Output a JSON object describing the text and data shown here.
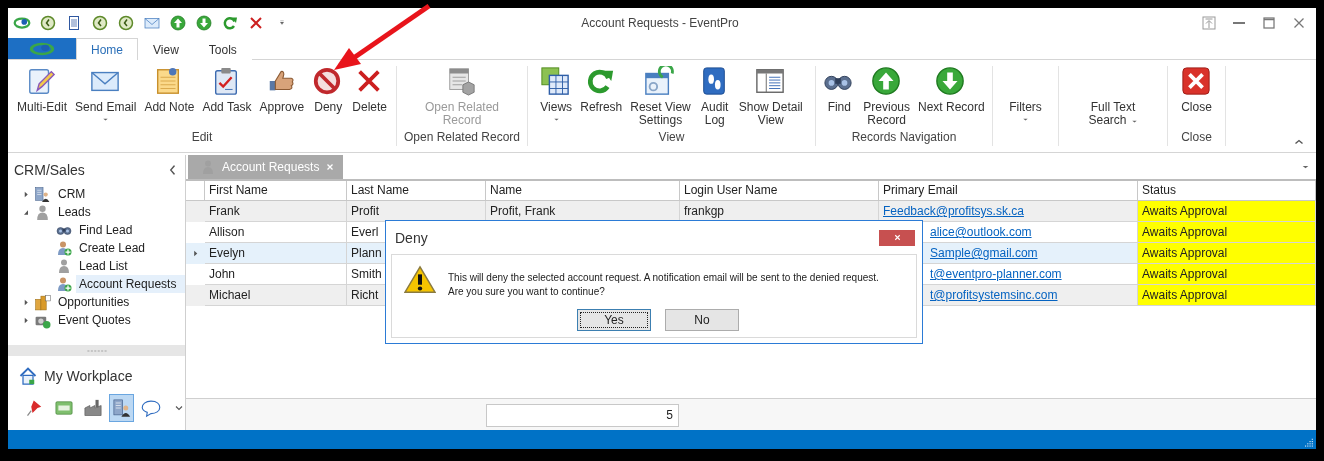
{
  "window": {
    "title": "Account Requests - EventPro"
  },
  "ribbon": {
    "tabs": [
      {
        "label": "Home",
        "selected": true
      },
      {
        "label": "View",
        "selected": false
      },
      {
        "label": "Tools",
        "selected": false
      }
    ],
    "groups": [
      {
        "label": "Edit",
        "buttons": [
          {
            "label": "Multi-Edit",
            "dropdown": false,
            "disabled": false
          },
          {
            "label": "Send Email",
            "dropdown": true,
            "disabled": false
          },
          {
            "label": "Add Note",
            "dropdown": false,
            "disabled": false
          },
          {
            "label": "Add Task",
            "dropdown": false,
            "disabled": false
          },
          {
            "label": "Approve",
            "dropdown": false,
            "disabled": false
          },
          {
            "label": "Deny",
            "dropdown": false,
            "disabled": false
          },
          {
            "label": "Delete",
            "dropdown": false,
            "disabled": false
          }
        ]
      },
      {
        "label": "Open Related Record",
        "buttons": [
          {
            "label": "Open Related\nRecord",
            "dropdown": false,
            "disabled": true
          }
        ]
      },
      {
        "label": "View",
        "buttons": [
          {
            "label": "Views",
            "dropdown": true,
            "disabled": false
          },
          {
            "label": "Refresh",
            "dropdown": false,
            "disabled": false
          },
          {
            "label": "Reset View\nSettings",
            "dropdown": false,
            "disabled": false
          },
          {
            "label": "Audit\nLog",
            "dropdown": false,
            "disabled": false
          },
          {
            "label": "Show Detail\nView",
            "dropdown": false,
            "disabled": false
          }
        ]
      },
      {
        "label": "Records Navigation",
        "buttons": [
          {
            "label": "Find",
            "dropdown": false,
            "disabled": false
          },
          {
            "label": "Previous\nRecord",
            "dropdown": false,
            "disabled": false
          },
          {
            "label": "Next Record",
            "dropdown": false,
            "disabled": false
          }
        ]
      },
      {
        "buttons": [
          {
            "label": "Filters",
            "dropdown": true,
            "disabled": false
          }
        ]
      },
      {
        "buttons": [
          {
            "label": "Full Text\nSearch",
            "dropdown": true,
            "disabled": false
          }
        ]
      },
      {
        "label": "Close",
        "buttons": [
          {
            "label": "Close",
            "dropdown": false,
            "disabled": false
          }
        ]
      }
    ]
  },
  "sidebar": {
    "title": "CRM/Sales",
    "tree": [
      {
        "label": "CRM",
        "expanded": false,
        "selected": false
      },
      {
        "label": "Leads",
        "expanded": true,
        "selected": false,
        "children": [
          {
            "label": "Find Lead",
            "selected": false
          },
          {
            "label": "Create Lead",
            "selected": false
          },
          {
            "label": "Lead List",
            "selected": false
          },
          {
            "label": "Account Requests",
            "selected": true
          }
        ]
      },
      {
        "label": "Opportunities",
        "expanded": false,
        "selected": false
      },
      {
        "label": "Event Quotes",
        "expanded": false,
        "selected": false
      }
    ],
    "workplace": "My Workplace",
    "nav_buttons": [
      {
        "selected": false
      },
      {
        "selected": false
      },
      {
        "selected": false
      },
      {
        "selected": true
      },
      {
        "selected": false
      }
    ]
  },
  "document_tab": {
    "label": "Account Requests"
  },
  "grid": {
    "columns": [
      {
        "label": "First Name",
        "kind": "text"
      },
      {
        "label": "Last Name",
        "kind": "text"
      },
      {
        "label": "Name",
        "kind": "text"
      },
      {
        "label": "Login User Name",
        "kind": "text"
      },
      {
        "label": "Primary Email",
        "kind": "link"
      },
      {
        "label": "Status",
        "kind": "text"
      }
    ],
    "rows": [
      {
        "selected": false,
        "highlighted": true,
        "cells": [
          "Frank",
          "Profit",
          "Profit, Frank",
          "frankgp",
          "Feedback@profitsys.sk.ca",
          "Awaits Approval"
        ]
      },
      {
        "selected": false,
        "highlighted": true,
        "cells": [
          "Allison",
          "Everl",
          null,
          null,
          {
            "text": "alice@outlook.com",
            "left_hidden": true
          },
          "Awaits Approval"
        ]
      },
      {
        "selected": true,
        "highlighted": true,
        "cells": [
          "Evelyn",
          "Plann",
          null,
          null,
          {
            "text": "Sample@gmail.com",
            "left_hidden": true
          },
          "Awaits Approval"
        ]
      },
      {
        "selected": false,
        "highlighted": true,
        "cells": [
          "John",
          "Smith",
          null,
          null,
          {
            "text": "t@eventpro-planner.com",
            "left_hidden": true
          },
          "Awaits Approval"
        ]
      },
      {
        "selected": false,
        "highlighted": true,
        "cells": [
          "Michael",
          "Richt",
          null,
          null,
          {
            "text": "t@profitsystemsinc.com",
            "left_hidden": true
          },
          "Awaits Approval"
        ]
      }
    ]
  },
  "footer": {
    "count": "5"
  },
  "dialog": {
    "title": "Deny",
    "message": "This will deny the selected account request. A notification email will be sent to the denied request.\nAre you sure you want to continue?",
    "buttons": [
      {
        "label": "Yes",
        "focused": true
      },
      {
        "label": "No",
        "focused": false
      }
    ]
  }
}
